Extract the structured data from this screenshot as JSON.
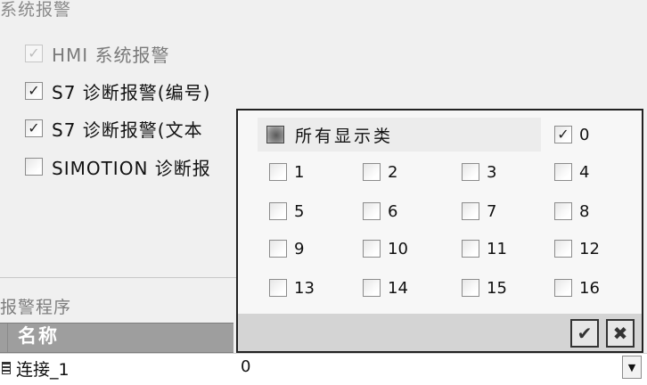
{
  "system_alarms": {
    "title": "系统报警",
    "options": [
      {
        "label": "HMI 系统报警",
        "checked": true,
        "disabled": true
      },
      {
        "label": "S7 诊断报警(编号)",
        "checked": true,
        "disabled": false
      },
      {
        "label": "S7 诊断报警(文本",
        "checked": true,
        "disabled": false
      },
      {
        "label": "SIMOTION 诊断报",
        "checked": false,
        "disabled": false
      }
    ]
  },
  "alarm_program": {
    "title": "报警程序",
    "column_header": "名称",
    "rows": [
      {
        "name": "连接_1",
        "value": "0"
      }
    ]
  },
  "popup": {
    "all_label": "所有显示类",
    "zero": {
      "label": "0",
      "checked": true
    },
    "items": [
      {
        "label": "1",
        "checked": false
      },
      {
        "label": "2",
        "checked": false
      },
      {
        "label": "3",
        "checked": false
      },
      {
        "label": "4",
        "checked": false
      },
      {
        "label": "5",
        "checked": false
      },
      {
        "label": "6",
        "checked": false
      },
      {
        "label": "7",
        "checked": false
      },
      {
        "label": "8",
        "checked": false
      },
      {
        "label": "9",
        "checked": false
      },
      {
        "label": "10",
        "checked": false
      },
      {
        "label": "11",
        "checked": false
      },
      {
        "label": "12",
        "checked": false
      },
      {
        "label": "13",
        "checked": false
      },
      {
        "label": "14",
        "checked": false
      },
      {
        "label": "15",
        "checked": false
      },
      {
        "label": "16",
        "checked": false
      }
    ],
    "ok_icon": "checkmark-icon",
    "cancel_icon": "cross-icon"
  }
}
